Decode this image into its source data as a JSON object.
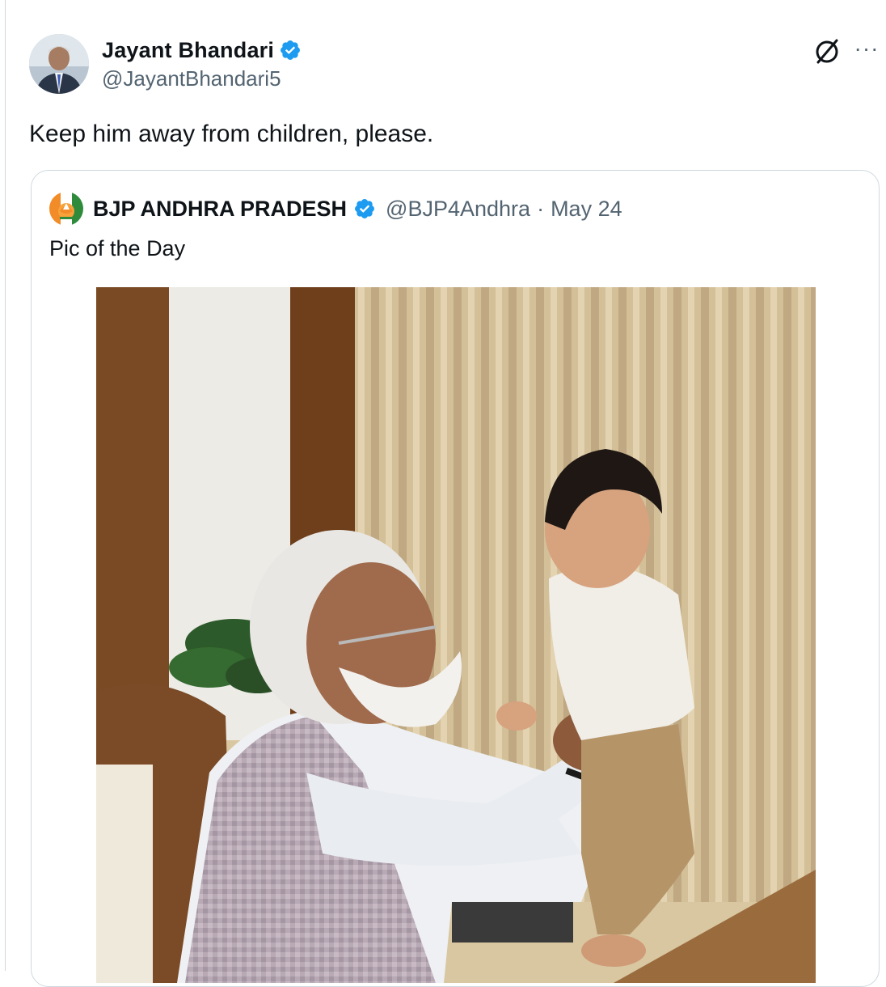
{
  "tweet": {
    "author_name": "Jayant Bhandari",
    "author_handle": "@JayantBhandari5",
    "text": "Keep him away from children, please."
  },
  "quoted_tweet": {
    "author_name": "BJP ANDHRA PRADESH",
    "author_handle": "@BJP4Andhra",
    "separator": "·",
    "date": "May 24",
    "text": "Pic of the Day"
  },
  "icons": {
    "verified": "verified-badge-icon",
    "grok": "grok-icon",
    "more": "more-options-icon"
  },
  "colors": {
    "verified_blue": "#1d9bf0",
    "secondary_text": "#536471",
    "border": "#cfd9de"
  }
}
